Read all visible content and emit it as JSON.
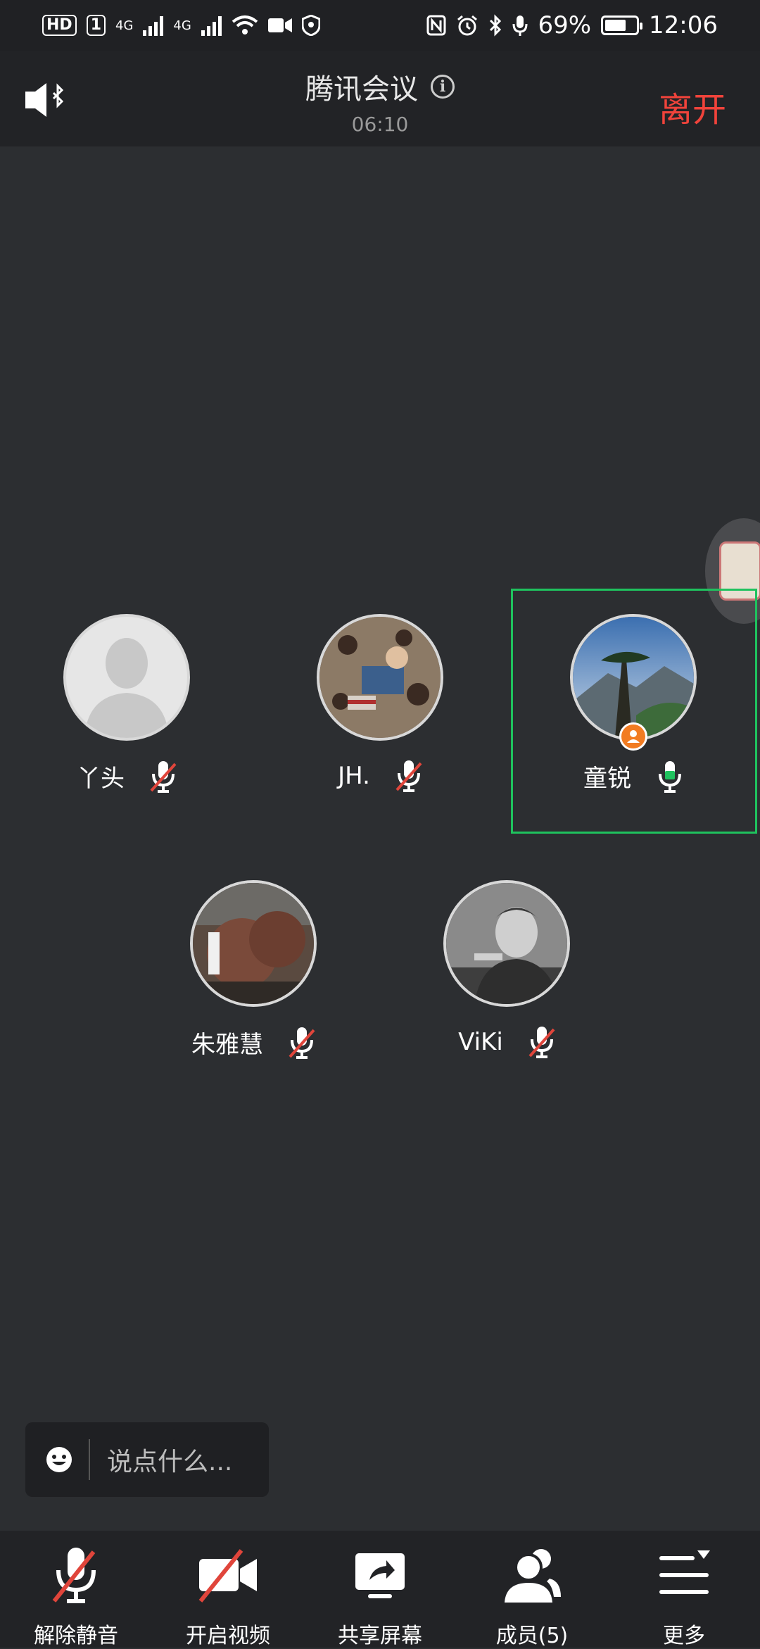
{
  "status_bar": {
    "left_chips": [
      "HD",
      "1"
    ],
    "net_1": "4G",
    "net_2": "4G",
    "battery": "69%",
    "battery_level": 0.69,
    "time": "12:06"
  },
  "header": {
    "title": "腾讯会议",
    "timer": "06:10",
    "leave_label": "离开"
  },
  "participants": [
    {
      "name": "丫头",
      "muted": true
    },
    {
      "name": "JH.",
      "muted": true
    },
    {
      "name": "童锐",
      "muted": false,
      "host": true,
      "active": true
    },
    {
      "name": "朱雅慧",
      "muted": true
    },
    {
      "name": "ViKi",
      "muted": true
    }
  ],
  "chat": {
    "placeholder": "说点什么..."
  },
  "toolbar": {
    "unmute": "解除静音",
    "start_video": "开启视频",
    "share_screen": "共享屏幕",
    "members": "成员(5)",
    "more": "更多"
  },
  "colors": {
    "background": "#2c2e31",
    "leave_red": "#f0433b",
    "active_green": "#1fc25e",
    "host_orange": "#f27c22",
    "mute_red": "#e0453b"
  }
}
